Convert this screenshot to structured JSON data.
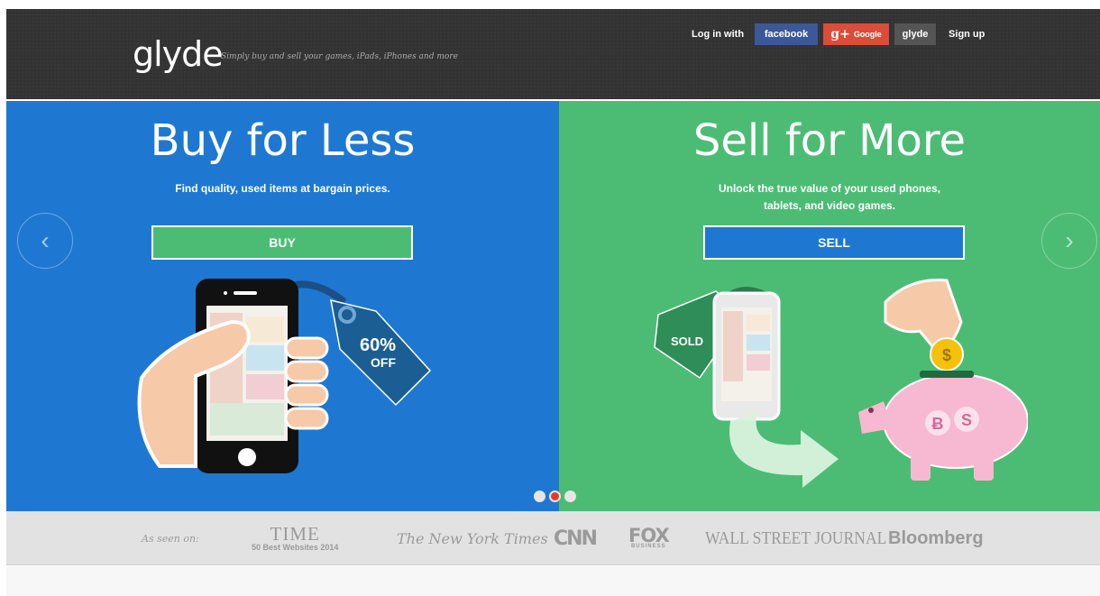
{
  "header": {
    "logo": "glyde",
    "tagline": "Simply buy and sell your games, iPads, iPhones and more",
    "login_label": "Log in with",
    "facebook_label": "facebook",
    "google_label": "Google",
    "glyde_label": "glyde",
    "signup_label": "Sign up"
  },
  "hero": {
    "buy": {
      "title": "Buy for Less",
      "subtitle": "Find quality, used items at bargain prices.",
      "button": "BUY",
      "tag_percent": "60%",
      "tag_off": "OFF"
    },
    "sell": {
      "title": "Sell for More",
      "subtitle_line1": "Unlock the true value of your used phones,",
      "subtitle_line2": "tablets, and video games.",
      "button": "SELL",
      "tag_sold": "SOLD",
      "coin": "$",
      "pig_symbol_1": "Ƀ",
      "pig_symbol_2": "S"
    },
    "prev_arrow": "‹",
    "next_arrow": "›",
    "slides": {
      "count": 3,
      "active_index": 1
    }
  },
  "press": {
    "label": "As seen on:",
    "time_line1": "TIME",
    "time_line2": "50 Best Websites 2014",
    "nyt": "The New York Times",
    "cnn": "CNN",
    "fox_line1": "FOX",
    "fox_line2": "BUSINESS",
    "wsj": "WALL STREET JOURNAL",
    "bloomberg": "Bloomberg"
  },
  "colors": {
    "header_bg": "#333333",
    "buy_bg": "#1e78d2",
    "sell_bg": "#4cbc74",
    "facebook": "#3b5998",
    "google": "#dd4b39",
    "active_dot": "#e23a2c"
  }
}
